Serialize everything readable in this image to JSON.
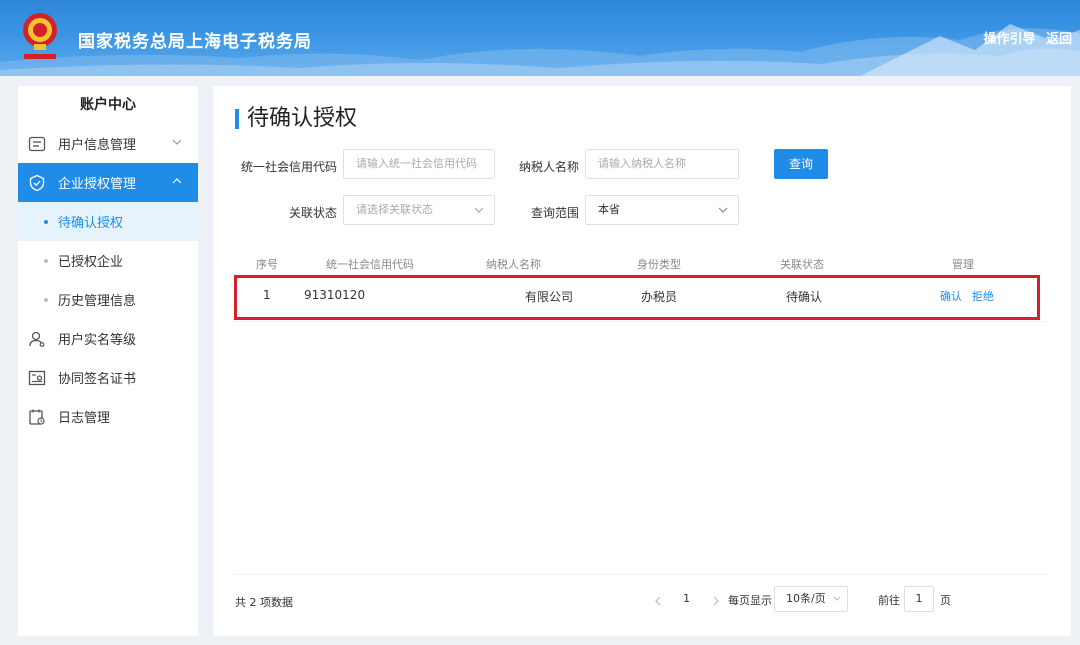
{
  "header": {
    "title": "国家税务总局上海电子税务局",
    "guide_link": "操作引导",
    "back_link": "返回"
  },
  "sidebar": {
    "title": "账户中心",
    "items": [
      {
        "label": "用户信息管理",
        "icon": "user-info-icon"
      },
      {
        "label": "企业授权管理",
        "icon": "enterprise-auth-icon"
      },
      {
        "label": "待确认授权"
      },
      {
        "label": "已授权企业"
      },
      {
        "label": "历史管理信息"
      },
      {
        "label": "用户实名等级",
        "icon": "user-level-icon"
      },
      {
        "label": "协同签名证书",
        "icon": "certificate-icon"
      },
      {
        "label": "日志管理",
        "icon": "log-icon"
      }
    ]
  },
  "main": {
    "title": "待确认授权",
    "form": {
      "credit_code_label": "统一社会信用代码",
      "credit_code_placeholder": "请输入统一社会信用代码",
      "taxpayer_name_label": "纳税人名称",
      "taxpayer_name_placeholder": "请输入纳税人名称",
      "query_button": "查询",
      "status_label": "关联状态",
      "status_placeholder": "请选择关联状态",
      "scope_label": "查询范围",
      "scope_value": "本省"
    },
    "table": {
      "headers": [
        "序号",
        "统一社会信用代码",
        "纳税人名称",
        "身份类型",
        "关联状态",
        "管理"
      ],
      "rows": [
        {
          "index": "1",
          "credit_code": "91310120",
          "taxpayer_name": "有限公司",
          "identity_type": "办税员",
          "status": "待确认",
          "action_confirm": "确认",
          "action_reject": "拒绝"
        }
      ]
    },
    "pagination": {
      "total_text": "共 2 项数据",
      "current_page": "1",
      "per_page_label": "每页显示",
      "per_page_value": "10条/页",
      "goto_label": "前往",
      "goto_value": "1",
      "page_suffix": "页"
    }
  },
  "colors": {
    "accent": "#1f8ce8",
    "highlight_border": "#d4202c",
    "header_bg": "#3b95e4"
  }
}
